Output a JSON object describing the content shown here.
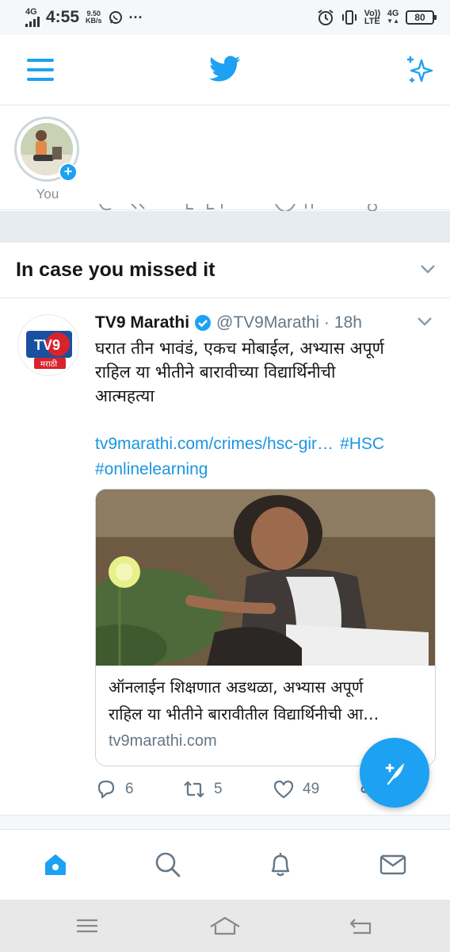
{
  "status_bar": {
    "network": "4G",
    "time": "4:55",
    "speed_value": "9.50",
    "speed_unit": "KB/s",
    "more": "···",
    "volte_top": "Vo))",
    "volte_bottom": "LTE",
    "network_right": "4G",
    "battery": "80",
    "icons": [
      "signal-icon",
      "whatsapp-icon",
      "alarm-icon",
      "vibrate-icon",
      "battery-icon"
    ]
  },
  "header": {
    "icons": [
      "menu-icon",
      "twitter-bird-icon",
      "sparkle-icon"
    ],
    "accent_color": "#1da1f2"
  },
  "fleets": {
    "items": [
      {
        "label": "You"
      }
    ]
  },
  "section": {
    "title": "In case you missed it"
  },
  "tweet": {
    "author_name": "TV9 Marathi",
    "verified": true,
    "handle": "@TV9Marathi",
    "separator": "·",
    "time": "18h",
    "avatar_text": "TV9",
    "avatar_sub": "मराठी",
    "text_lines": [
      "घरात तीन भावंडं, एकच मोबाईल, अभ्यास अपूर्ण",
      "राहिल या भीतीने बारावीच्या विद्यार्थिनीची",
      "आत्महत्या"
    ],
    "link": "tv9marathi.com/crimes/hsc-gir…",
    "hashtag1": "#HSC",
    "hashtag2": "#onlinelearning",
    "card": {
      "title_line1": "ऑनलाईन शिक्षणात अडथळा, अभ्यास अपूर्ण",
      "title_line2": "राहिल या भीतीने बारावीतील विद्यार्थिनीची आ…",
      "domain": "tv9marathi.com"
    },
    "replies": "6",
    "retweets": "5",
    "likes": "49"
  },
  "bottom_nav": {
    "items": [
      "home-icon",
      "search-icon",
      "notifications-icon",
      "messages-icon"
    ],
    "active": "home-icon"
  },
  "system_nav": {
    "items": [
      "recents-icon",
      "home-button-icon",
      "back-icon"
    ]
  }
}
